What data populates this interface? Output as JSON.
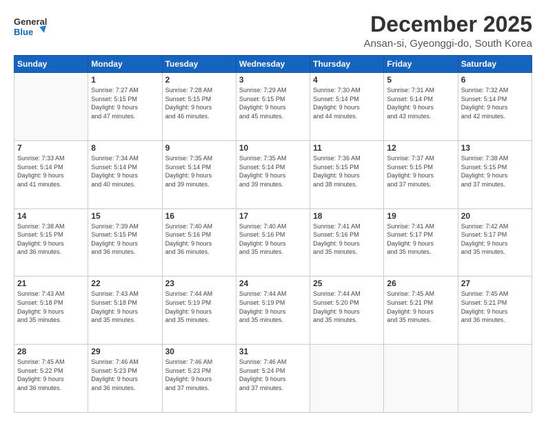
{
  "header": {
    "logo_general": "General",
    "logo_blue": "Blue",
    "month": "December 2025",
    "location": "Ansan-si, Gyeonggi-do, South Korea"
  },
  "weekdays": [
    "Sunday",
    "Monday",
    "Tuesday",
    "Wednesday",
    "Thursday",
    "Friday",
    "Saturday"
  ],
  "weeks": [
    [
      {
        "day": "",
        "info": ""
      },
      {
        "day": "1",
        "info": "Sunrise: 7:27 AM\nSunset: 5:15 PM\nDaylight: 9 hours\nand 47 minutes."
      },
      {
        "day": "2",
        "info": "Sunrise: 7:28 AM\nSunset: 5:15 PM\nDaylight: 9 hours\nand 46 minutes."
      },
      {
        "day": "3",
        "info": "Sunrise: 7:29 AM\nSunset: 5:15 PM\nDaylight: 9 hours\nand 45 minutes."
      },
      {
        "day": "4",
        "info": "Sunrise: 7:30 AM\nSunset: 5:14 PM\nDaylight: 9 hours\nand 44 minutes."
      },
      {
        "day": "5",
        "info": "Sunrise: 7:31 AM\nSunset: 5:14 PM\nDaylight: 9 hours\nand 43 minutes."
      },
      {
        "day": "6",
        "info": "Sunrise: 7:32 AM\nSunset: 5:14 PM\nDaylight: 9 hours\nand 42 minutes."
      }
    ],
    [
      {
        "day": "7",
        "info": "Sunrise: 7:33 AM\nSunset: 5:14 PM\nDaylight: 9 hours\nand 41 minutes."
      },
      {
        "day": "8",
        "info": "Sunrise: 7:34 AM\nSunset: 5:14 PM\nDaylight: 9 hours\nand 40 minutes."
      },
      {
        "day": "9",
        "info": "Sunrise: 7:35 AM\nSunset: 5:14 PM\nDaylight: 9 hours\nand 39 minutes."
      },
      {
        "day": "10",
        "info": "Sunrise: 7:35 AM\nSunset: 5:14 PM\nDaylight: 9 hours\nand 39 minutes."
      },
      {
        "day": "11",
        "info": "Sunrise: 7:36 AM\nSunset: 5:15 PM\nDaylight: 9 hours\nand 38 minutes."
      },
      {
        "day": "12",
        "info": "Sunrise: 7:37 AM\nSunset: 5:15 PM\nDaylight: 9 hours\nand 37 minutes."
      },
      {
        "day": "13",
        "info": "Sunrise: 7:38 AM\nSunset: 5:15 PM\nDaylight: 9 hours\nand 37 minutes."
      }
    ],
    [
      {
        "day": "14",
        "info": "Sunrise: 7:38 AM\nSunset: 5:15 PM\nDaylight: 9 hours\nand 36 minutes."
      },
      {
        "day": "15",
        "info": "Sunrise: 7:39 AM\nSunset: 5:15 PM\nDaylight: 9 hours\nand 36 minutes."
      },
      {
        "day": "16",
        "info": "Sunrise: 7:40 AM\nSunset: 5:16 PM\nDaylight: 9 hours\nand 36 minutes."
      },
      {
        "day": "17",
        "info": "Sunrise: 7:40 AM\nSunset: 5:16 PM\nDaylight: 9 hours\nand 35 minutes."
      },
      {
        "day": "18",
        "info": "Sunrise: 7:41 AM\nSunset: 5:16 PM\nDaylight: 9 hours\nand 35 minutes."
      },
      {
        "day": "19",
        "info": "Sunrise: 7:41 AM\nSunset: 5:17 PM\nDaylight: 9 hours\nand 35 minutes."
      },
      {
        "day": "20",
        "info": "Sunrise: 7:42 AM\nSunset: 5:17 PM\nDaylight: 9 hours\nand 35 minutes."
      }
    ],
    [
      {
        "day": "21",
        "info": "Sunrise: 7:43 AM\nSunset: 5:18 PM\nDaylight: 9 hours\nand 35 minutes."
      },
      {
        "day": "22",
        "info": "Sunrise: 7:43 AM\nSunset: 5:18 PM\nDaylight: 9 hours\nand 35 minutes."
      },
      {
        "day": "23",
        "info": "Sunrise: 7:44 AM\nSunset: 5:19 PM\nDaylight: 9 hours\nand 35 minutes."
      },
      {
        "day": "24",
        "info": "Sunrise: 7:44 AM\nSunset: 5:19 PM\nDaylight: 9 hours\nand 35 minutes."
      },
      {
        "day": "25",
        "info": "Sunrise: 7:44 AM\nSunset: 5:20 PM\nDaylight: 9 hours\nand 35 minutes."
      },
      {
        "day": "26",
        "info": "Sunrise: 7:45 AM\nSunset: 5:21 PM\nDaylight: 9 hours\nand 35 minutes."
      },
      {
        "day": "27",
        "info": "Sunrise: 7:45 AM\nSunset: 5:21 PM\nDaylight: 9 hours\nand 36 minutes."
      }
    ],
    [
      {
        "day": "28",
        "info": "Sunrise: 7:45 AM\nSunset: 5:22 PM\nDaylight: 9 hours\nand 36 minutes."
      },
      {
        "day": "29",
        "info": "Sunrise: 7:46 AM\nSunset: 5:23 PM\nDaylight: 9 hours\nand 36 minutes."
      },
      {
        "day": "30",
        "info": "Sunrise: 7:46 AM\nSunset: 5:23 PM\nDaylight: 9 hours\nand 37 minutes."
      },
      {
        "day": "31",
        "info": "Sunrise: 7:46 AM\nSunset: 5:24 PM\nDaylight: 9 hours\nand 37 minutes."
      },
      {
        "day": "",
        "info": ""
      },
      {
        "day": "",
        "info": ""
      },
      {
        "day": "",
        "info": ""
      }
    ]
  ]
}
